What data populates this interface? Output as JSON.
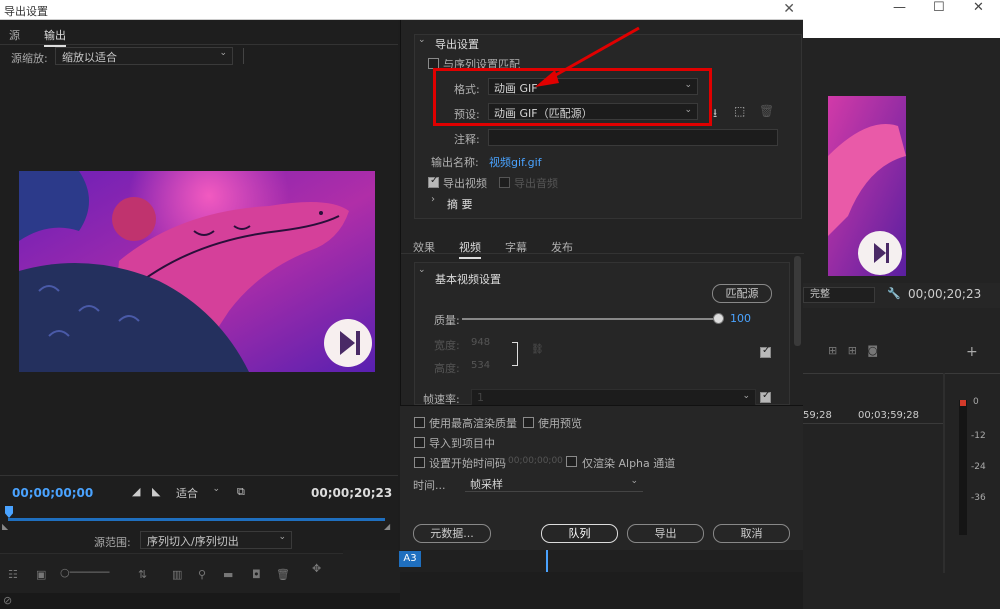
{
  "dialog": {
    "title": "导出设置"
  },
  "left": {
    "tabs": [
      "源",
      "输出"
    ],
    "zoom_label": "源缩放:",
    "zoom_value": "缩放以适合",
    "timecode_current": "00;00;00;00",
    "fit_value": "适合",
    "timecode_total": "00;00;20;23",
    "range_label": "源范围:",
    "range_value": "序列切入/序列切出"
  },
  "export_settings": {
    "header": "导出设置",
    "match_sequence": "与序列设置匹配",
    "format_label": "格式:",
    "format_value": "动画 GIF",
    "preset_label": "预设:",
    "preset_value": "动画 GIF（匹配源）",
    "comment_label": "注释:",
    "output_name_label": "输出名称:",
    "output_name_value": "视频gif.gif",
    "export_video": "导出视频",
    "export_audio": "导出音频",
    "summary": "摘 要"
  },
  "tabs2": [
    "效果",
    "视频",
    "字幕",
    "发布"
  ],
  "basic_video": {
    "header": "基本视频设置",
    "match_source_button": "匹配源",
    "quality_label": "质量:",
    "quality_value": "100",
    "quality": 1.0,
    "width_label": "宽度:",
    "width_value": "948",
    "height_label": "高度:",
    "height_value": "534",
    "fps_label": "帧速率:",
    "fps_value": "1"
  },
  "options": {
    "max_render": "使用最高渲染质量",
    "use_preview": "使用预览",
    "import_project": "导入到项目中",
    "set_start_tc": "设置开始时间码",
    "start_tc_value": "00;00;00;00",
    "alpha_only": "仅渲染 Alpha 通道",
    "time_label": "时间...",
    "time_value": "帧采样"
  },
  "buttons": {
    "metadata": "元数据...",
    "queue": "队列",
    "export": "导出",
    "cancel": "取消"
  },
  "background": {
    "timecode": "00;00;20;23",
    "complete": "完整",
    "ruler": [
      "59;28",
      "00;03;59;28"
    ],
    "meter": [
      "0",
      "-12",
      "-24",
      "-36"
    ],
    "track": "A3"
  },
  "colors": {
    "accent": "#4aa3ff",
    "highlight_box": "#e00000",
    "arrow": "#e00000"
  }
}
